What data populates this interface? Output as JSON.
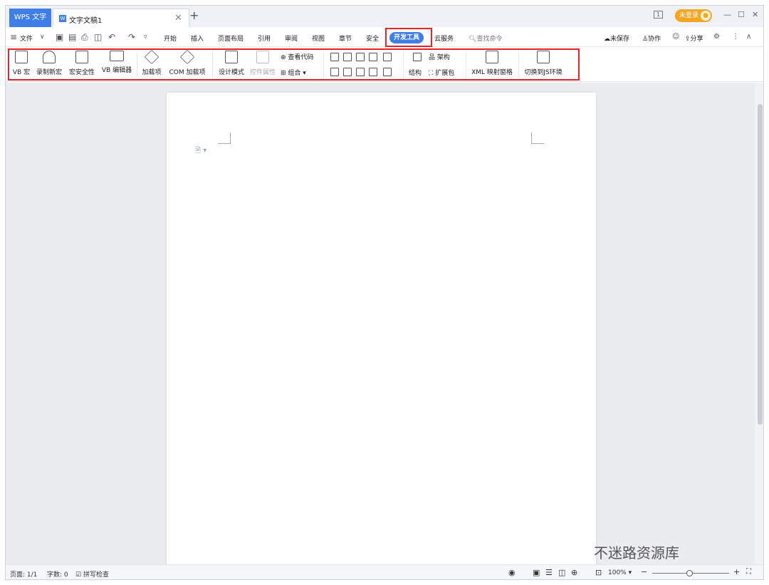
{
  "titlebar": {
    "app_tab": "WPS 文字",
    "doc_tab": "文字文稿1",
    "login_label": "未登录",
    "page_indicator": "1"
  },
  "menubar": {
    "file_label": "文件",
    "tabs": [
      "开始",
      "插入",
      "页面布局",
      "引用",
      "审阅",
      "视图",
      "章节",
      "安全",
      "开发工具",
      "云服务"
    ],
    "active_tab": "开发工具",
    "search_placeholder": "查找命令",
    "unsaved": "未保存",
    "collab": "协作",
    "share": "分享"
  },
  "ribbon": {
    "vb_macro": "VB 宏",
    "record_macro": "录制新宏",
    "macro_security": "宏安全性",
    "vb_editor": "VB 编辑器",
    "addins": "加载项",
    "com_addins": "COM 加载项",
    "design_mode": "设计模式",
    "control_props": "控件属性",
    "view_code": "查看代码",
    "group": "组合",
    "structure": "结构",
    "schema": "架构",
    "expansion_pack": "扩展包",
    "xml_mapping": "XML 映射窗格",
    "switch_js": "切换到JS环境"
  },
  "statusbar": {
    "page": "页面: 1/1",
    "words": "字数: 0",
    "spell": "拼写检查",
    "zoom": "100%"
  },
  "watermark": "不迷路资源库",
  "colors": {
    "accent": "#3f7ee8",
    "highlight": "#e8222a",
    "login": "#f5a623"
  }
}
